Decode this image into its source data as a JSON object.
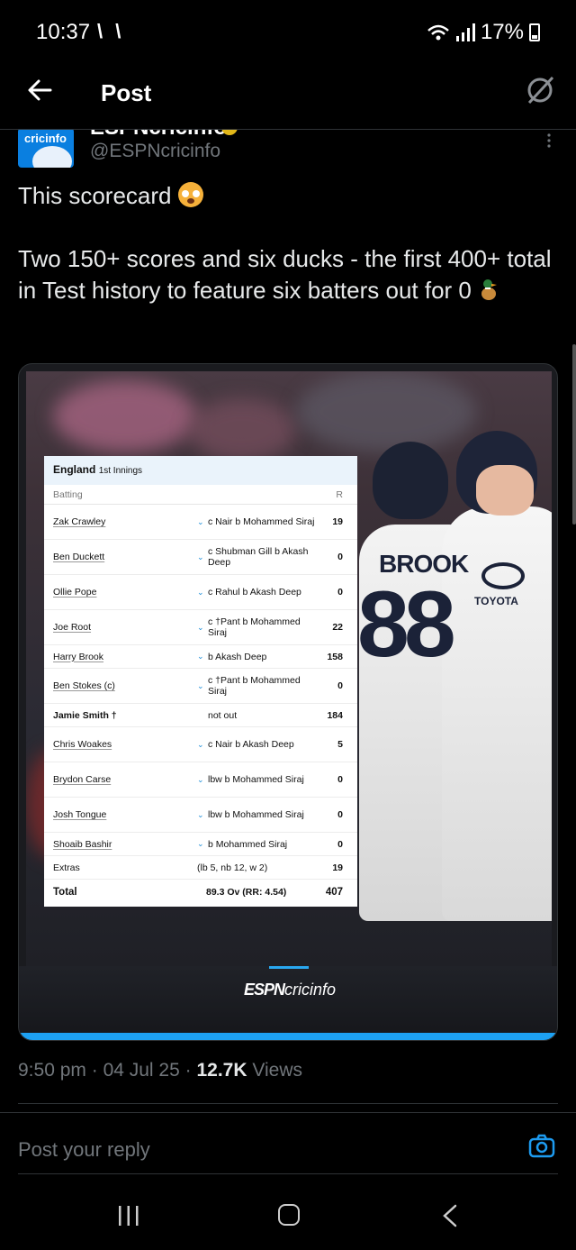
{
  "status_bar": {
    "time": "10:37",
    "left_icons": "\\ \\",
    "battery": "17%"
  },
  "header": {
    "title": "Post"
  },
  "author": {
    "avatar_text": "cricinfo",
    "name": "ESPNcricinfo",
    "handle": "@ESPNcricinfo"
  },
  "tweet": {
    "line1": "This scorecard",
    "line2": "Two 150+ scores and six ducks - the first 400+ total in Test history to feature six batters out for 0"
  },
  "media": {
    "jersey_name": "BROOK",
    "jersey_number": "88",
    "sponsor": "TOYOTA",
    "brand_bold": "ESPN",
    "brand_rest": "cricinfo"
  },
  "scorecard": {
    "team": "England",
    "innings": "1st Innings",
    "col_batting": "Batting",
    "col_runs": "R",
    "rows": [
      {
        "name": "Zak Crawley",
        "dismissal": "c Nair b Mohammed Siraj",
        "runs": "19",
        "chev": true
      },
      {
        "name": "Ben Duckett",
        "dismissal": "c Shubman Gill b Akash Deep",
        "runs": "0",
        "chev": true
      },
      {
        "name": "Ollie Pope",
        "dismissal": "c Rahul b Akash Deep",
        "runs": "0",
        "chev": true
      },
      {
        "name": "Joe Root",
        "dismissal": "c †Pant b Mohammed Siraj",
        "runs": "22",
        "chev": true
      },
      {
        "name": "Harry Brook",
        "dismissal": "b Akash Deep",
        "runs": "158",
        "chev": true,
        "short": true
      },
      {
        "name": "Ben Stokes (c)",
        "dismissal": "c †Pant b Mohammed Siraj",
        "runs": "0",
        "chev": true
      },
      {
        "name": "Jamie Smith †",
        "dismissal": "not out",
        "runs": "184",
        "chev": false,
        "short": true,
        "bold": true
      },
      {
        "name": "Chris Woakes",
        "dismissal": "c Nair b Akash Deep",
        "runs": "5",
        "chev": true
      },
      {
        "name": "Brydon Carse",
        "dismissal": "lbw b Mohammed Siraj",
        "runs": "0",
        "chev": true
      },
      {
        "name": "Josh Tongue",
        "dismissal": "lbw b Mohammed Siraj",
        "runs": "0",
        "chev": true
      },
      {
        "name": "Shoaib Bashir",
        "dismissal": "b Mohammed Siraj",
        "runs": "0",
        "chev": true,
        "short": true
      }
    ],
    "extras": {
      "label": "Extras",
      "detail": "(lb 5, nb 12, w 2)",
      "runs": "19"
    },
    "total": {
      "label": "Total",
      "detail": "89.3 Ov (RR: 4.54)",
      "runs": "407"
    }
  },
  "meta": {
    "time": "9:50 pm",
    "date": "04 Jul 25",
    "views_count": "12.7K",
    "views_label": "Views"
  },
  "reply": {
    "placeholder": "Post your reply"
  },
  "colors": {
    "accent": "#1d9bf0",
    "background": "#000000",
    "muted": "#71767b"
  }
}
